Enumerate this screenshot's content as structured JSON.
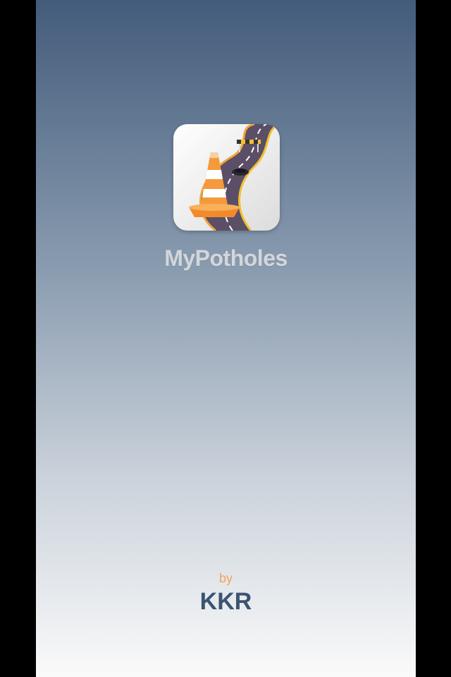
{
  "app": {
    "name": "MyPotholes",
    "icon": "road-cone-pothole-icon"
  },
  "credit": {
    "by": "by",
    "company": "KKR"
  },
  "colors": {
    "gradient_top": "#435c7b",
    "gradient_bottom": "#fafafa",
    "app_name": "#d3d6db",
    "by_text": "#f0a45a",
    "company_text": "#3c5472"
  }
}
